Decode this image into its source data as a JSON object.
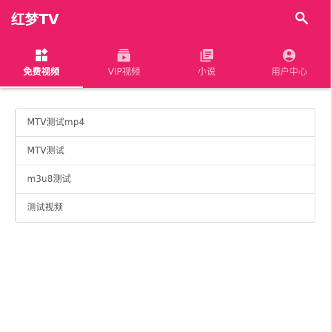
{
  "app": {
    "title": "红梦TV",
    "accent_color": "#ea1f67"
  },
  "header": {
    "search_icon": "search-icon"
  },
  "tabs": [
    {
      "label": "免费视频",
      "icon": "dashboard-icon",
      "active": true
    },
    {
      "label": "VIP视频",
      "icon": "subscriptions-icon",
      "active": false
    },
    {
      "label": "小说",
      "icon": "library-books-icon",
      "active": false
    },
    {
      "label": "用户中心",
      "icon": "account-circle-icon",
      "active": false
    }
  ],
  "videos": [
    {
      "title": "MTV测试mp4"
    },
    {
      "title": "MTV测试"
    },
    {
      "title": "m3u8测试"
    },
    {
      "title": "测试视频"
    }
  ]
}
